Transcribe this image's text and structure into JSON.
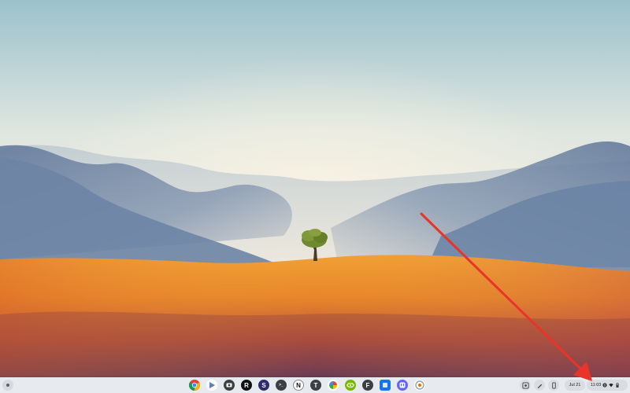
{
  "shelf": {
    "apps": [
      {
        "name": "chrome-icon",
        "letter": ""
      },
      {
        "name": "play-store-icon",
        "letter": ""
      },
      {
        "name": "camera-icon",
        "letter": ""
      },
      {
        "name": "roblox-icon",
        "letter": "R"
      },
      {
        "name": "app-icon-5",
        "letter": "S"
      },
      {
        "name": "terminal-icon",
        "letter": ">_"
      },
      {
        "name": "notion-icon",
        "letter": "N"
      },
      {
        "name": "app-icon-t",
        "letter": "T"
      },
      {
        "name": "pinwheel-icon",
        "letter": ""
      },
      {
        "name": "nvidia-icon",
        "letter": ""
      },
      {
        "name": "app-icon-f",
        "letter": "F"
      },
      {
        "name": "app-icon-blue",
        "letter": ""
      },
      {
        "name": "mastodon-icon",
        "letter": ""
      },
      {
        "name": "chrome-beta-icon",
        "letter": ""
      }
    ],
    "date": "Jul 21",
    "time": "11:03"
  },
  "colors": {
    "sky_top": "#9fc3cc",
    "sky_glow": "#f2efe3",
    "mountain": "#6f86a6",
    "dune": "#e9902a",
    "arrow": "#e8342a"
  }
}
